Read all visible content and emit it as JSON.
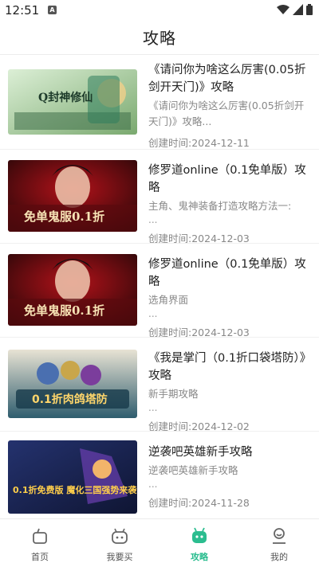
{
  "status": {
    "time": "12:51",
    "sim_label": "A"
  },
  "header": {
    "title": "攻略"
  },
  "articles": [
    {
      "title": "《请问你为啥这么厉害(0.05折剑开天门)》攻略",
      "desc": "《请问你为啥这么厉害(0.05折剑开天门)》攻略...",
      "dots": "",
      "date": "创建时间:2024-12-11",
      "thumb_text": "Q封神修仙",
      "thumb_colors": [
        "#cfe6c8",
        "#6ea36a"
      ]
    },
    {
      "title": "修罗道online（0.1免单版）攻略",
      "desc": "主角、鬼神装备打造攻略方法一:",
      "dots": "...",
      "date": "创建时间:2024-12-03",
      "thumb_text": "免单鬼服0.1折",
      "thumb_colors": [
        "#3a0f10",
        "#b3121a"
      ]
    },
    {
      "title": "修罗道online（0.1免单版）攻略",
      "desc": "选角界面",
      "dots": "...",
      "date": "创建时间:2024-12-03",
      "thumb_text": "免单鬼服0.1折",
      "thumb_colors": [
        "#3a0f10",
        "#b3121a"
      ]
    },
    {
      "title": "《我是掌门（0.1折口袋塔防）》攻略",
      "desc": "新手期攻略",
      "dots": "...",
      "date": "创建时间:2024-12-02",
      "thumb_text": "0.1折肉鸽塔防",
      "thumb_colors": [
        "#d9d4c4",
        "#2f5d6e"
      ]
    },
    {
      "title": "逆袭吧英雄新手攻略",
      "desc": "逆袭吧英雄新手攻略",
      "dots": "...",
      "date": "创建时间:2024-11-28",
      "thumb_text": "0.1折免费版 魔化三国强势来袭",
      "thumb_colors": [
        "#1d2a5a",
        "#e06b1f"
      ]
    }
  ],
  "tabs": [
    {
      "label": "首页",
      "icon": "home-icon",
      "active": false
    },
    {
      "label": "我要买",
      "icon": "shop-icon",
      "active": false
    },
    {
      "label": "攻略",
      "icon": "guide-icon",
      "active": true
    },
    {
      "label": "我的",
      "icon": "profile-icon",
      "active": false
    }
  ],
  "colors": {
    "accent": "#2bbd8f",
    "text": "#222222",
    "muted": "#888888"
  }
}
